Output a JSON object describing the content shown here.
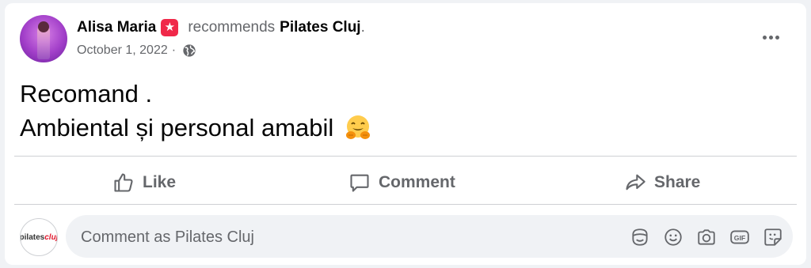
{
  "post": {
    "author": "Alisa Maria",
    "verb": "recommends",
    "page_name": "Pilates Cluj",
    "period": ".",
    "date": "October 1, 2022",
    "date_sep": "·",
    "audience_icon": "globe-icon",
    "recommend_icon": "recommend-star-icon",
    "text_line1": "Recomand .",
    "text_line2": "Ambiental și personal amabil",
    "emoji": "hugging-face-emoji"
  },
  "actions": {
    "like": "Like",
    "comment": "Comment",
    "share": "Share"
  },
  "composer": {
    "placeholder": "Comment as Pilates Cluj",
    "page_avatar_text": "pilates",
    "page_avatar_accent": "cluj",
    "tools": [
      "avatar-sticker-icon",
      "emoji-icon",
      "camera-icon",
      "gif-icon",
      "sticker-icon"
    ]
  },
  "colors": {
    "secondary_text": "#65676b",
    "recommend_red": "#f02849",
    "divider": "#ced0d4",
    "input_bg": "#f0f2f5"
  }
}
